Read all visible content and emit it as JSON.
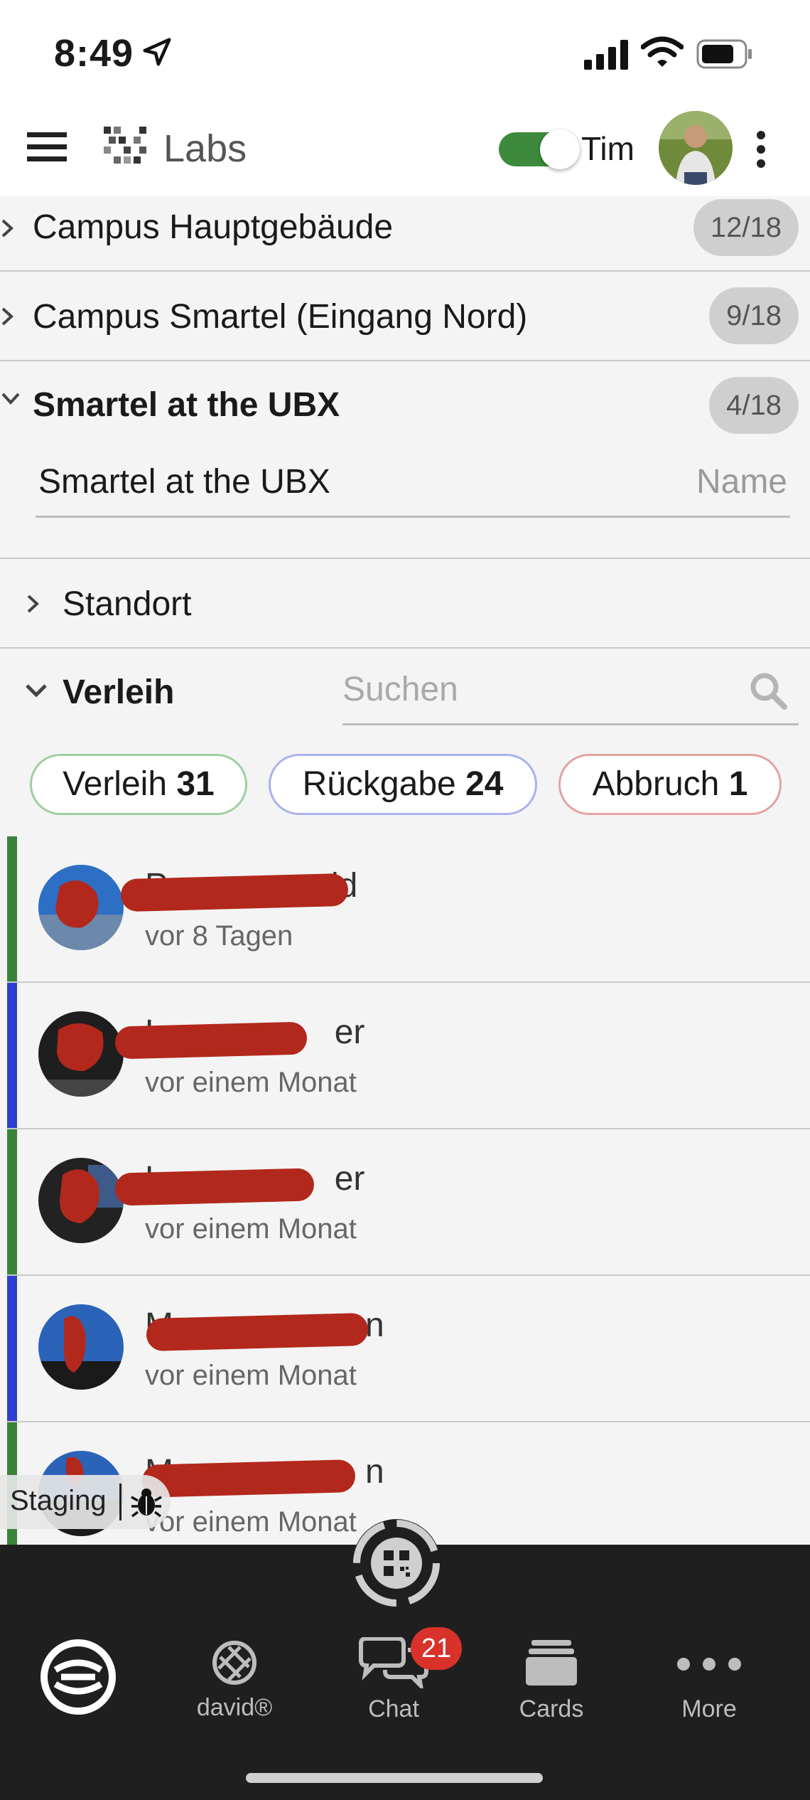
{
  "status_bar": {
    "time": "8:49"
  },
  "header": {
    "app_title": "Labs",
    "toggle_on": true,
    "user_name": "Tim"
  },
  "locations": [
    {
      "name": "Campus Hauptgebäude",
      "count": "12/18",
      "expanded": false
    },
    {
      "name": "Campus Smartel (Eingang Nord)",
      "count": "9/18",
      "expanded": false
    },
    {
      "name": "Smartel at the UBX",
      "count": "4/18",
      "expanded": true
    }
  ],
  "details": {
    "name_value": "Smartel at the UBX",
    "name_label": "Name",
    "standort_label": "Standort",
    "verleih_label": "Verleih",
    "search_placeholder": "Suchen"
  },
  "filters": [
    {
      "label": "Verleih",
      "count": "31",
      "color": "#9fcf9f"
    },
    {
      "label": "Rückgabe",
      "count": "24",
      "color": "#a8b2ef"
    },
    {
      "label": "Abbruch",
      "count": "1",
      "color": "#e3a3a3"
    }
  ],
  "rentals": [
    {
      "name_visible_start": "P",
      "name_visible_end": "ld",
      "time": "vor 8 Tagen",
      "status_color": "#3a843a"
    },
    {
      "name_visible_start": "L",
      "name_visible_end": "er",
      "time": "vor einem Monat",
      "status_color": "#2f3fcf"
    },
    {
      "name_visible_start": "L",
      "name_visible_end": "er",
      "time": "vor einem Monat",
      "status_color": "#3a843a"
    },
    {
      "name_visible_start": "M",
      "name_visible_end": "n",
      "time": "vor einem Monat",
      "status_color": "#2f3fcf"
    },
    {
      "name_visible_start": "M",
      "name_visible_end": "n",
      "time": "vor einem Monat",
      "status_color": "#3a843a"
    }
  ],
  "staging": {
    "label": "Staging"
  },
  "bottom_nav": {
    "items": [
      {
        "label": "",
        "icon": "home-logo-icon"
      },
      {
        "label": "david®",
        "icon": "david-icon"
      },
      {
        "label": "Chat",
        "icon": "chat-icon",
        "badge": "21"
      },
      {
        "label": "Cards",
        "icon": "cards-icon"
      },
      {
        "label": "More",
        "icon": "more-icon"
      }
    ]
  }
}
